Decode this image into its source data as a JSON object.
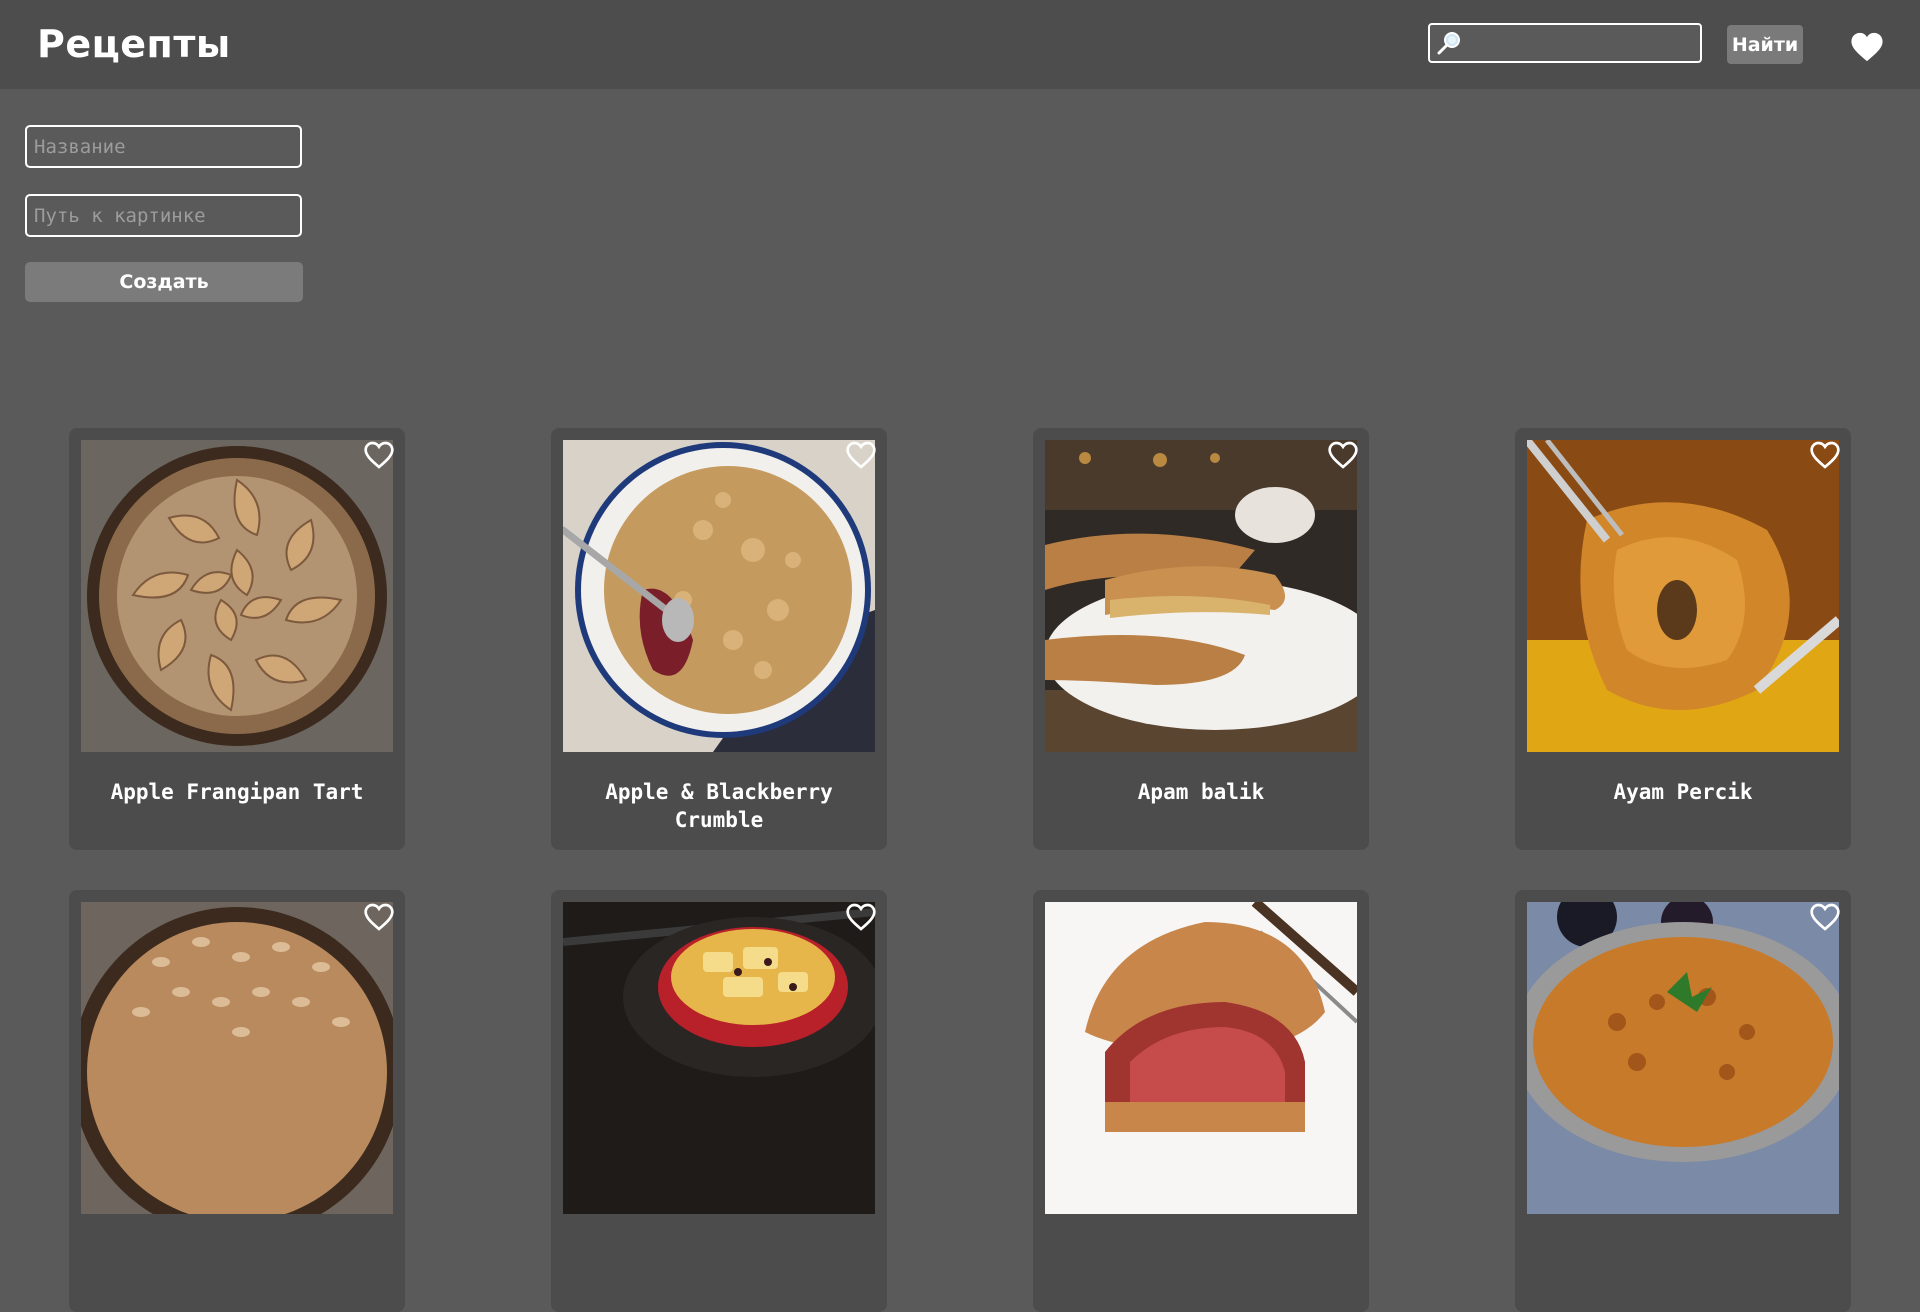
{
  "header": {
    "title": "Рецепты",
    "search": {
      "value": "",
      "placeholder": ""
    },
    "search_button_label": "Найти"
  },
  "create_form": {
    "name_placeholder": "Название",
    "image_path_placeholder": "Путь к картинке",
    "submit_label": "Создать"
  },
  "recipes": [
    {
      "title": "Apple Frangipan Tart",
      "image": "apple-frangipan-tart-photo"
    },
    {
      "title": "Apple & Blackberry Crumble",
      "image": "apple-blackberry-crumble-photo"
    },
    {
      "title": "Apam balik",
      "image": "apam-balik-photo"
    },
    {
      "title": "Ayam Percik",
      "image": "ayam-percik-photo"
    },
    {
      "title": "",
      "image": "almond-tart-photo"
    },
    {
      "title": "",
      "image": "bread-pudding-skillet-photo"
    },
    {
      "title": "",
      "image": "beef-wellington-photo"
    },
    {
      "title": "",
      "image": "curry-pan-photo"
    }
  ],
  "colors": {
    "background": "#5a5a5a",
    "header": "#4d4d4d",
    "card": "#4c4c4c",
    "button": "#7b7b7b",
    "text": "#ffffff"
  }
}
